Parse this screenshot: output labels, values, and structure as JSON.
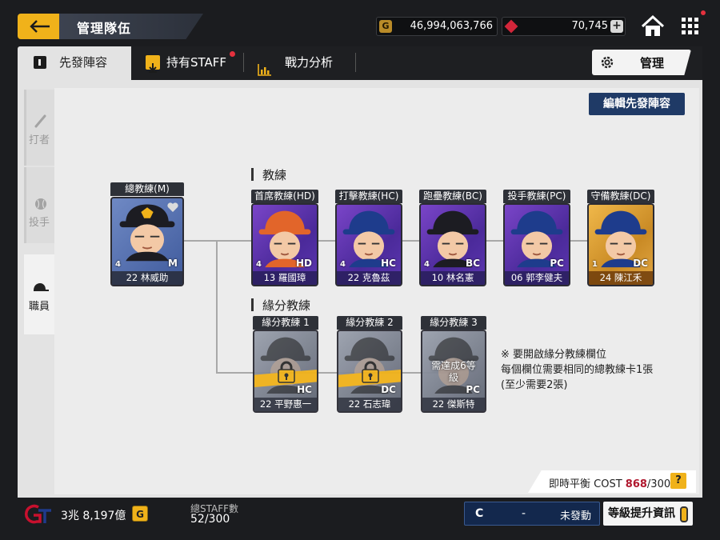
{
  "header": {
    "title": "管理隊伍",
    "gold": "46,994,063,766",
    "gold_icon": "G",
    "gems": "70,745",
    "gem_plus": "+"
  },
  "tabs": [
    {
      "label": "先發陣容",
      "active": true
    },
    {
      "label": "持有STAFF",
      "badge": true
    },
    {
      "label": "戰力分析"
    }
  ],
  "manage_label": "管理",
  "side": [
    {
      "label": "打者",
      "active": false
    },
    {
      "label": "投手",
      "active": false
    },
    {
      "label": "職員",
      "active": true
    }
  ],
  "edit_button": "編輯先發陣容",
  "head_coach": {
    "slot": "總教練(M)",
    "name": "22 林威助",
    "pos": "M",
    "level": "4",
    "frame": "blue"
  },
  "coach_section": "教練",
  "coaches": [
    {
      "slot": "首席教練(HD)",
      "name": "13 羅國璋",
      "pos": "HD",
      "level": "4",
      "frame": "purple"
    },
    {
      "slot": "打擊教練(HC)",
      "name": "22 克魯茲",
      "pos": "HC",
      "level": "4",
      "frame": "purple"
    },
    {
      "slot": "跑壘教練(BC)",
      "name": "10 林名憲",
      "pos": "BC",
      "level": "4",
      "frame": "purple"
    },
    {
      "slot": "投手教練(PC)",
      "name": "06 郭李健夫",
      "pos": "PC",
      "level": "",
      "frame": "purple"
    },
    {
      "slot": "守備教練(DC)",
      "name": "24 陳江禾",
      "pos": "DC",
      "level": "1",
      "frame": "gold"
    }
  ],
  "bond_section": "緣分教練",
  "bond_coaches": [
    {
      "slot": "緣分教練 1",
      "name": "22 平野惠一",
      "pos": "HC",
      "locked": true
    },
    {
      "slot": "緣分教練 2",
      "name": "22 石志瑋",
      "pos": "DC",
      "locked": true
    },
    {
      "slot": "緣分教練 3",
      "name": "22 傑斯特",
      "pos": "PC",
      "locked": false,
      "requirement": "需達成6等級"
    }
  ],
  "notes": {
    "line1": "※ 要開啟緣分教練欄位",
    "line2": "每個欄位需要相同的總教練卡1張",
    "line3": "(至少需要2張)"
  },
  "cost": {
    "label": "即時平衡 COST",
    "current": "868",
    "max": "/300",
    "help": "?"
  },
  "footer": {
    "money": "3兆 8,197億",
    "g_badge": "G",
    "staff_total_label": "總STAFF數",
    "staff_total_value": "52/300",
    "combo_grade": "C",
    "combo_dash": "-",
    "combo_state": "未發動",
    "upgrade_label": "等級提升資訊"
  },
  "colors": {
    "accent": "#f0b21a",
    "navy": "#1f3a66",
    "red": "#e5313e"
  }
}
